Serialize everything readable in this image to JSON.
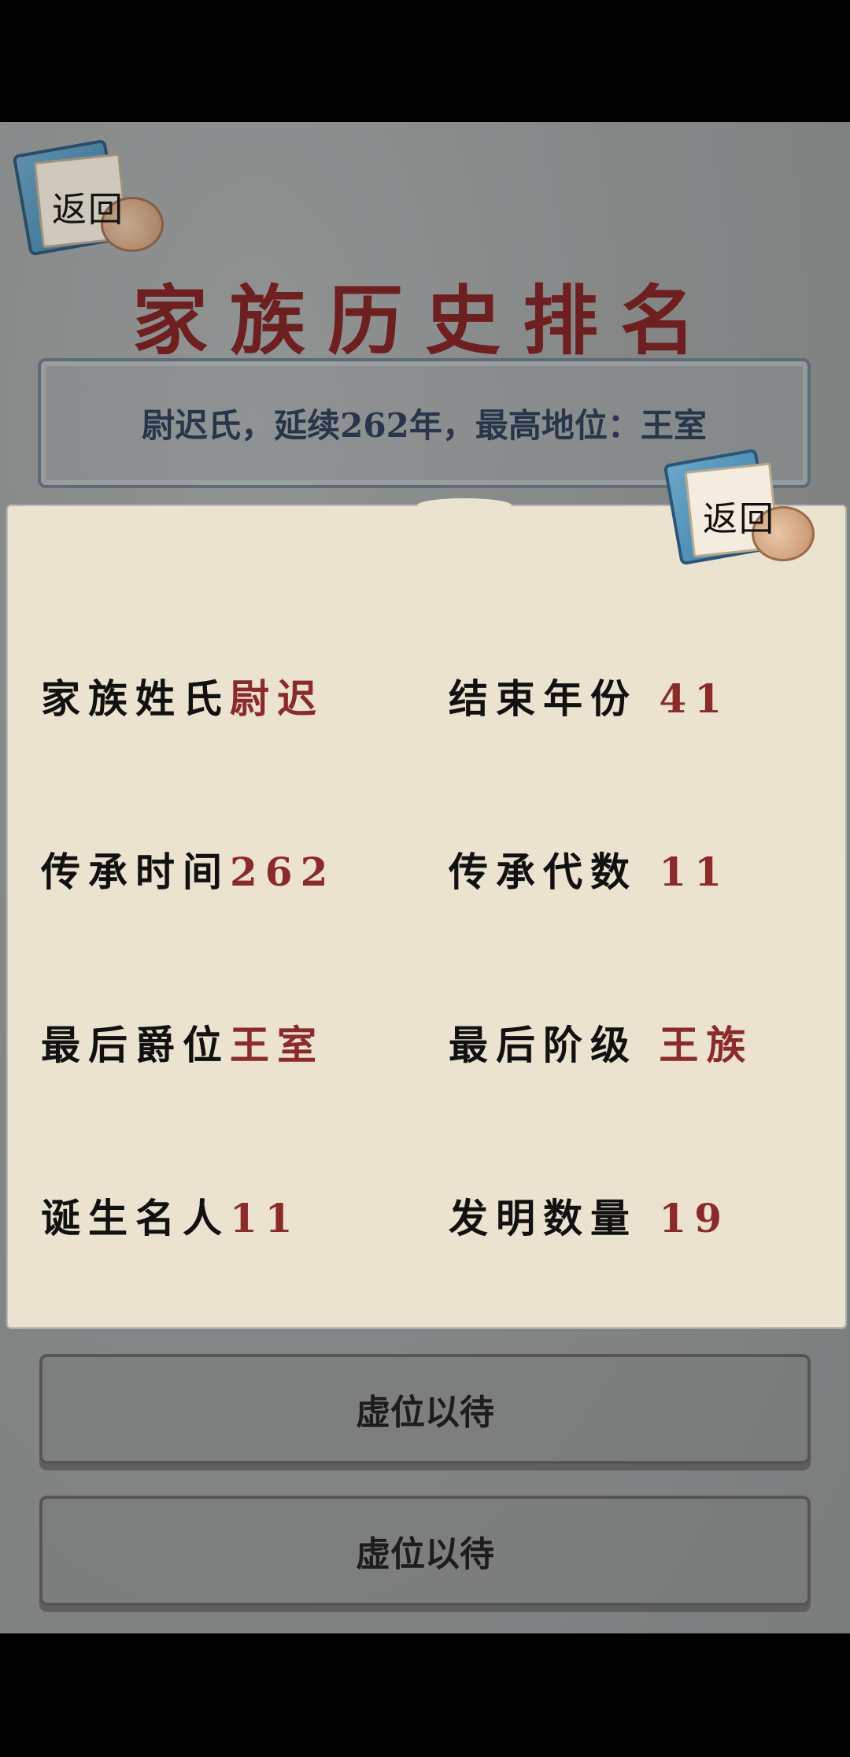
{
  "header": {
    "back_label": "返回",
    "title": "家族历史排名"
  },
  "summary": {
    "text": "尉迟氏，延续262年，最高地位：王室"
  },
  "ranking_rows": [
    {
      "label": "虚位以待"
    },
    {
      "label": "虚位以待"
    }
  ],
  "popup": {
    "back_label": "返回",
    "stats": [
      {
        "key": "家族姓氏",
        "value": "尉迟"
      },
      {
        "key": "结束年份 ",
        "value": "41"
      },
      {
        "key": "传承时间",
        "value": "262"
      },
      {
        "key": "传承代数 ",
        "value": "11"
      },
      {
        "key": "最后爵位",
        "value": "王室"
      },
      {
        "key": "最后阶级 ",
        "value": "王族"
      },
      {
        "key": "诞生名人",
        "value": "11"
      },
      {
        "key": "发明数量 ",
        "value": "19"
      }
    ]
  },
  "colors": {
    "title": "#6e1f1f",
    "value": "#8b2a2a",
    "parchment": "#ebe2cf",
    "summary_text": "#27364a"
  }
}
